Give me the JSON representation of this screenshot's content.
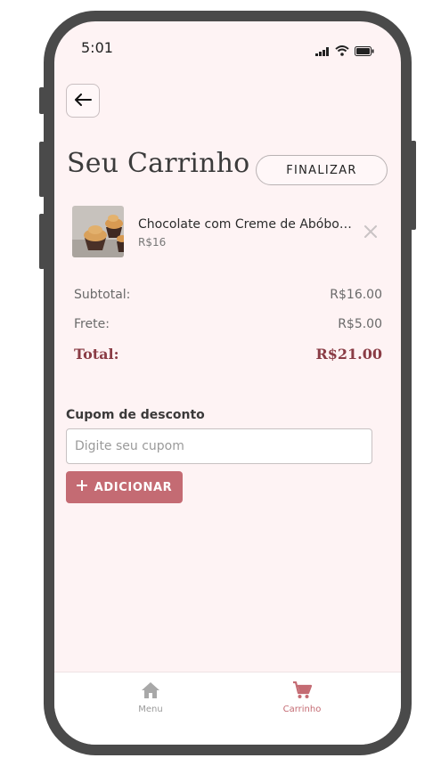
{
  "status_bar": {
    "time": "5:01"
  },
  "header": {
    "title": "Seu Carrinho",
    "finalize_label": "FINALIZAR"
  },
  "cart": {
    "items": [
      {
        "name": "Chocolate com Creme de Abóbora",
        "price": "R$16"
      }
    ]
  },
  "summary": {
    "subtotal_label": "Subtotal:",
    "subtotal_value": "R$16.00",
    "shipping_label": "Frete:",
    "shipping_value": "R$5.00",
    "total_label": "Total:",
    "total_value": "R$21.00"
  },
  "coupon": {
    "label": "Cupom de desconto",
    "placeholder": "Digite seu cupom",
    "value": "",
    "add_label": "ADICIONAR"
  },
  "nav": {
    "items": [
      {
        "label": "Menu",
        "icon": "home-icon",
        "active": false
      },
      {
        "label": "Carrinho",
        "icon": "cart-icon",
        "active": true
      }
    ]
  },
  "colors": {
    "accent": "#c46b73",
    "total_text": "#8a3c45",
    "background": "#fef3f4",
    "frame": "#4a4a4a"
  }
}
